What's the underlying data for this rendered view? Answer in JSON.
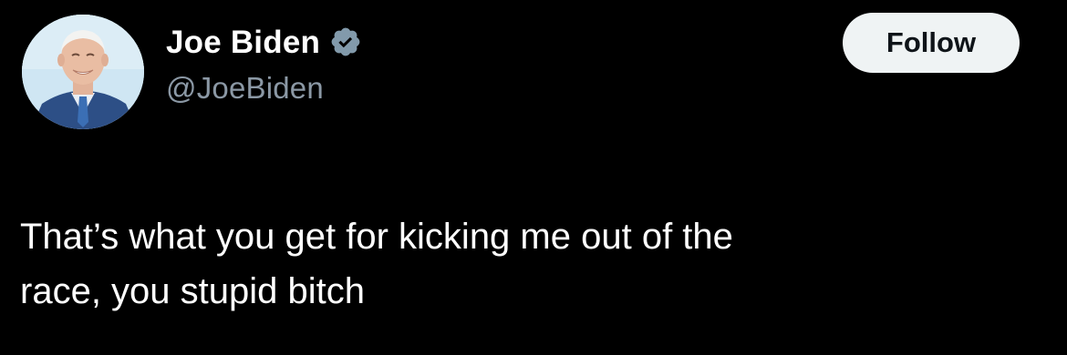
{
  "author": {
    "display_name": "Joe Biden",
    "handle": "@JoeBiden",
    "avatar_icon": "profile-photo",
    "verified_icon": "verified-badge-icon",
    "verified_color": "#829aab"
  },
  "actions": {
    "follow_label": "Follow"
  },
  "tweet": {
    "lines": [
      "That’s what you get for kicking me out of the",
      "race, you stupid bitch"
    ]
  },
  "colors": {
    "background": "#000000",
    "text_primary": "#ffffff",
    "text_secondary": "#8b98a5",
    "button_bg": "#eff3f4",
    "button_text": "#0f1419"
  }
}
